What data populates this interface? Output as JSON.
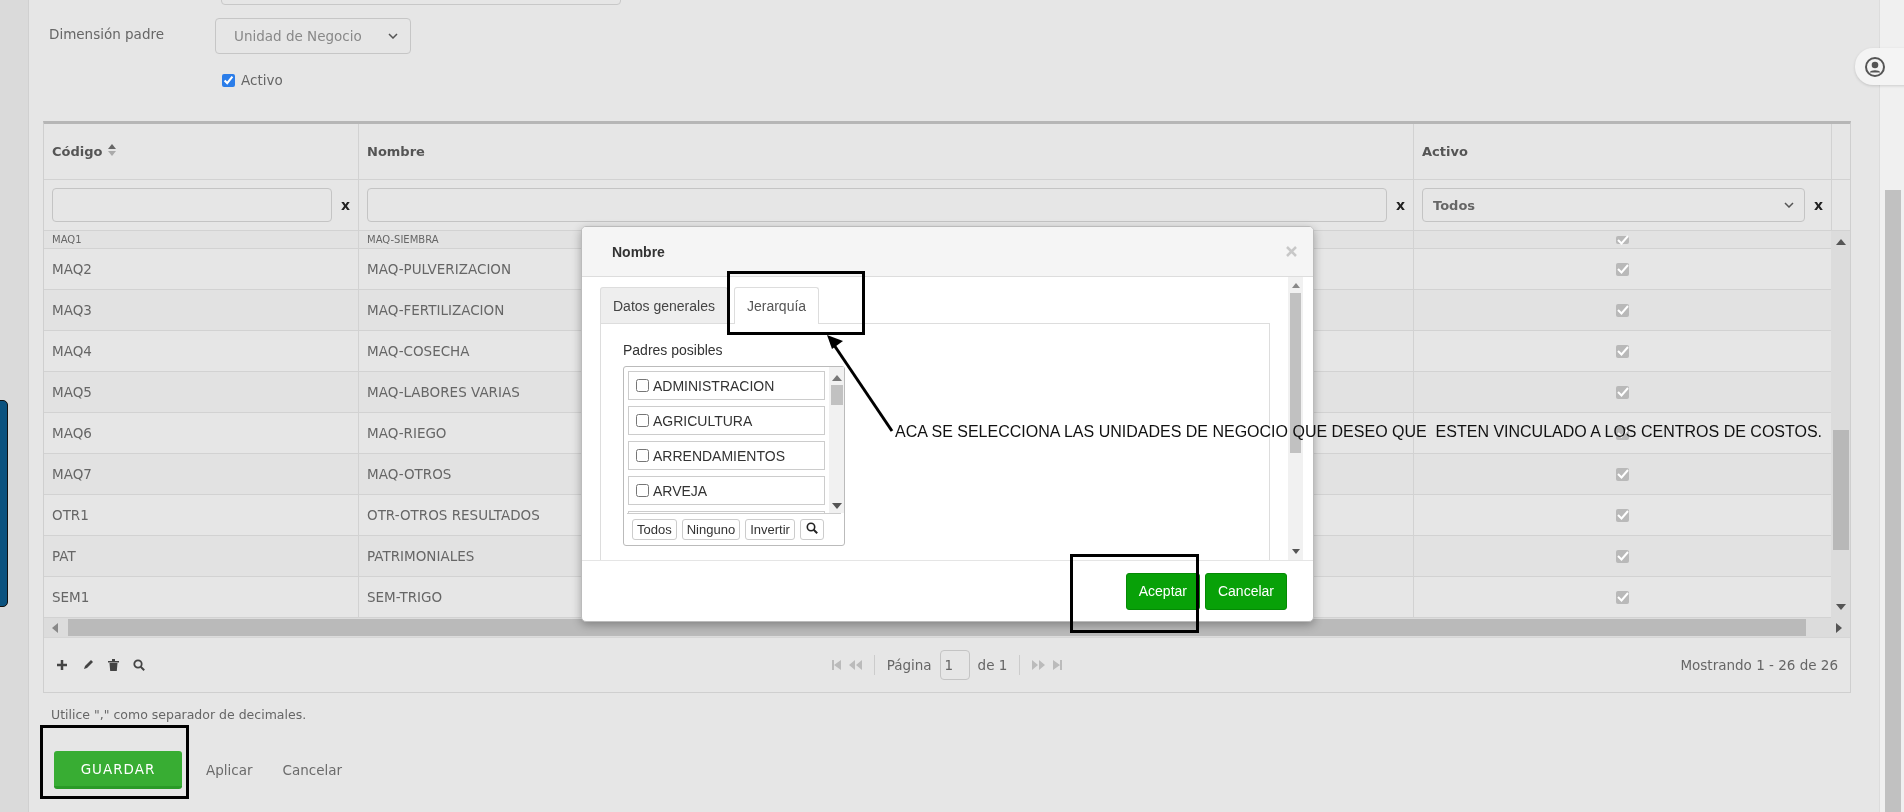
{
  "form": {
    "parent_dimension": {
      "label": "Dimensión padre",
      "value": "Unidad de Negocio"
    },
    "active": {
      "label": "Activo",
      "checked": true
    }
  },
  "table": {
    "columns": [
      {
        "label": "Código",
        "sortable": true
      },
      {
        "label": "Nombre",
        "sortable": false
      },
      {
        "label": "Activo",
        "sortable": false
      }
    ],
    "filters": [
      {
        "kind": "text",
        "clear": "x"
      },
      {
        "kind": "text",
        "clear": "x"
      },
      {
        "kind": "select",
        "value": "Todos",
        "clear": "x"
      }
    ],
    "rows": [
      {
        "code": "MAQ1",
        "name": "MAQ-SIEMBRA",
        "active": true
      },
      {
        "code": "MAQ2",
        "name": "MAQ-PULVERIZACION",
        "active": true
      },
      {
        "code": "MAQ3",
        "name": "MAQ-FERTILIZACION",
        "active": true
      },
      {
        "code": "MAQ4",
        "name": "MAQ-COSECHA",
        "active": true
      },
      {
        "code": "MAQ5",
        "name": "MAQ-LABORES VARIAS",
        "active": true
      },
      {
        "code": "MAQ6",
        "name": "MAQ-RIEGO",
        "active": true
      },
      {
        "code": "MAQ7",
        "name": "MAQ-OTROS",
        "active": true
      },
      {
        "code": "OTR1",
        "name": "OTR-OTROS RESULTADOS",
        "active": true
      },
      {
        "code": "PAT",
        "name": "PATRIMONIALES",
        "active": true
      },
      {
        "code": "SEM1",
        "name": "SEM-TRIGO",
        "active": true
      }
    ],
    "pager": {
      "page_label": "Página",
      "page": "1",
      "of": "de 1"
    },
    "summary": "Mostrando 1 - 26 de 26"
  },
  "note": "Utilice \",\" como separador de decimales.",
  "actions": [
    {
      "label": "GUARDAR",
      "kind": "primary"
    },
    {
      "label": "Aplicar",
      "kind": "link"
    },
    {
      "label": "Cancelar",
      "kind": "link"
    }
  ],
  "dialog": {
    "title": "Nombre",
    "tabs": [
      {
        "label": "Datos generales",
        "selected": false
      },
      {
        "label": "Jerarquía",
        "selected": true
      }
    ],
    "list_label": "Padres posibles",
    "options": [
      {
        "label": "ADMINISTRACION",
        "checked": false
      },
      {
        "label": "AGRICULTURA",
        "checked": false
      },
      {
        "label": "ARRENDAMIENTOS",
        "checked": false
      },
      {
        "label": "ARVEJA",
        "checked": false
      }
    ],
    "list_buttons": [
      "Todos",
      "Ninguno",
      "Invertir"
    ],
    "buttons": [
      {
        "label": "Aceptar"
      },
      {
        "label": "Cancelar"
      }
    ]
  },
  "annotation": {
    "text": "ACA SE SELECCIONA LAS UNIDADES DE NEGOCIO QUE DESEO QUE  ESTEN VINCULADO A LOS CENTROS DE COSTOS."
  }
}
